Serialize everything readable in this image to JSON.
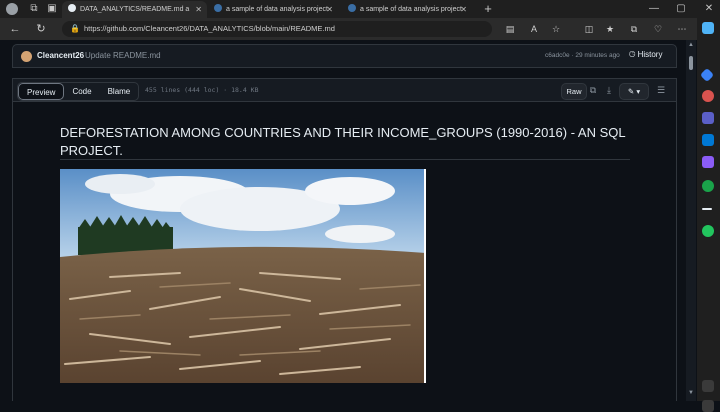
{
  "browser": {
    "tabs": [
      {
        "label": "DATA_ANALYTICS/README.md a"
      },
      {
        "label": "a sample of data analysis project"
      },
      {
        "label": "a sample of data analysis project"
      }
    ],
    "url": "https://github.com/Cleancent26/DATA_ANALYTICS/blob/main/README.md"
  },
  "commit": {
    "user": "Cleancent26",
    "message": "Update README.md",
    "meta": "c6adc0e · 29 minutes ago",
    "history_label": "History"
  },
  "file": {
    "tabs": [
      "Preview",
      "Code",
      "Blame"
    ],
    "meta": "455 lines (444 loc) · 18.4 KB",
    "raw_label": "Raw"
  },
  "readme": {
    "title": "DEFORESTATION AMONG COUNTRIES AND THEIR INCOME_GROUPS (1990-2016) - AN SQL PROJECT."
  }
}
